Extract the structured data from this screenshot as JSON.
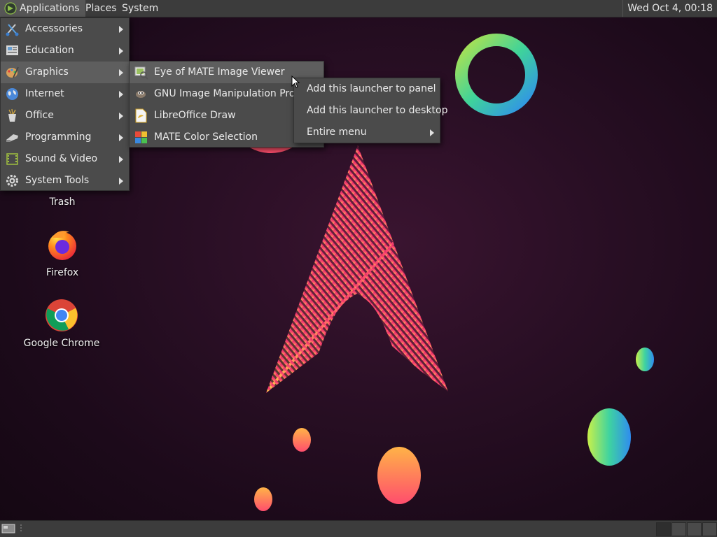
{
  "top_panel": {
    "menus": [
      "Applications",
      "Places",
      "System"
    ],
    "clock": "Wed Oct  4, 00:18"
  },
  "applications_menu": {
    "items": [
      {
        "label": "Accessories",
        "icon": "accessories-icon"
      },
      {
        "label": "Education",
        "icon": "education-icon"
      },
      {
        "label": "Graphics",
        "icon": "graphics-icon"
      },
      {
        "label": "Internet",
        "icon": "internet-icon"
      },
      {
        "label": "Office",
        "icon": "office-icon"
      },
      {
        "label": "Programming",
        "icon": "programming-icon"
      },
      {
        "label": "Sound & Video",
        "icon": "sound-video-icon"
      },
      {
        "label": "System Tools",
        "icon": "system-tools-icon"
      }
    ],
    "highlighted": "Graphics"
  },
  "graphics_submenu": {
    "items": [
      {
        "label": "Eye of MATE Image Viewer",
        "icon": "image-viewer-icon"
      },
      {
        "label": "GNU Image Manipulation Program",
        "icon": "gimp-icon"
      },
      {
        "label": "LibreOffice Draw",
        "icon": "libreoffice-draw-icon"
      },
      {
        "label": "MATE Color Selection",
        "icon": "color-selection-icon"
      }
    ],
    "highlighted": "Eye of MATE Image Viewer"
  },
  "context_menu": {
    "items": [
      {
        "label": "Add this launcher to panel"
      },
      {
        "label": "Add this launcher to desktop"
      },
      {
        "label": "Entire menu"
      }
    ]
  },
  "desktop_icons": [
    {
      "label": "Trash",
      "icon": "trash-icon"
    },
    {
      "label": "Firefox",
      "icon": "firefox-icon"
    },
    {
      "label": "Google Chrome",
      "icon": "chrome-icon"
    }
  ]
}
